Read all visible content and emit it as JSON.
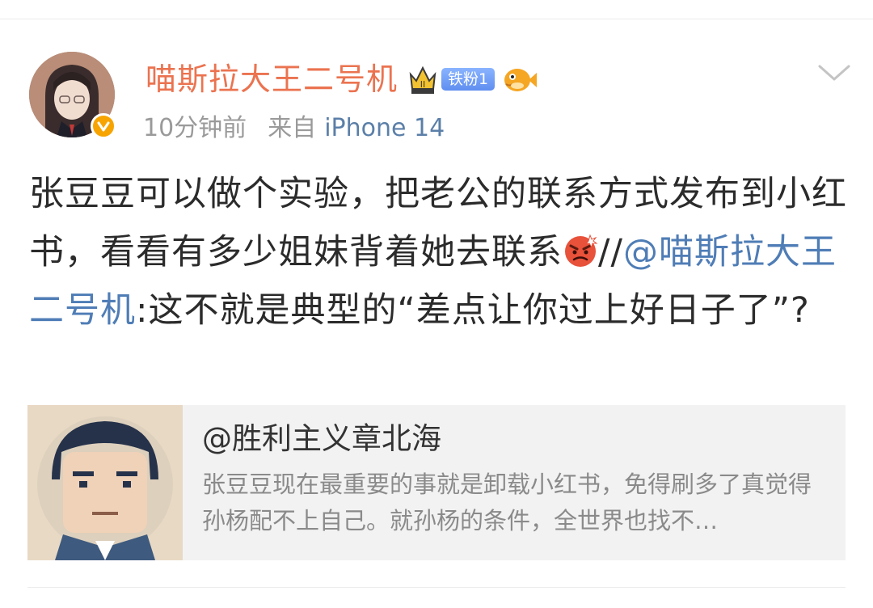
{
  "post": {
    "author": {
      "name": "喵斯拉大王二号机",
      "fan_badge": "铁粉1",
      "verified": true
    },
    "time": "10分钟前",
    "source_prefix": "来自",
    "device": "iPhone 14",
    "text": {
      "part1": "张豆豆可以做个实验，把老公的联系方式发布到小红书，看看有多少姐妹背着她去联系",
      "separator": "//",
      "mention": "@喵斯拉大王二号机",
      "part2": ":这不就是典型的“差点让你过上好日子了”?"
    },
    "icons": {
      "avatar": "anime-girl-avatar",
      "verified": "verified-badge-icon",
      "crown": "crown-icon",
      "fish": "pufferfish-icon",
      "emoji": "angry-face-emoji",
      "more": "chevron-down-icon"
    }
  },
  "quote": {
    "author": "@胜利主义章北海",
    "excerpt": "张豆豆现在最重要的事就是卸载小红书，免得刷多了真觉得孙杨配不上自己。就孙杨的条件，全世界也找不…"
  },
  "colors": {
    "username": "#eb7350",
    "link": "#4f7db6",
    "meta": "#9a9a9a",
    "card_bg": "#f2f2f2",
    "verified_badge": "#f7a400",
    "fan_badge": "#6f9cf5"
  }
}
